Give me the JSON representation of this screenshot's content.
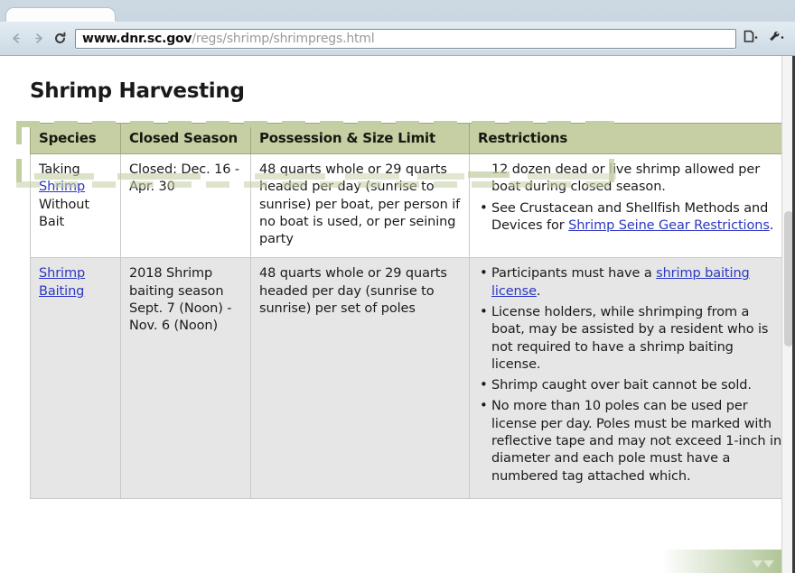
{
  "browser": {
    "tab_title": "",
    "back_icon": "back-arrow-icon",
    "forward_icon": "forward-arrow-icon",
    "reload_icon": "reload-icon",
    "url_host": "www.dnr.sc.gov",
    "url_path": "/regs/shrimp/shrimpregs.html",
    "url_full": "www.dnr.sc.gov/regs/shrimp/shrimpregs.html",
    "page_menu_icon": "page-menu-icon",
    "wrench_menu_icon": "wrench-menu-icon"
  },
  "page": {
    "title": "Shrimp Harvesting",
    "table": {
      "headers": [
        "Species",
        "Closed Season",
        "Possession & Size Limit",
        "Restrictions"
      ],
      "rows": [
        {
          "species_prefix": "Taking ",
          "species_link": "Shrimp",
          "species_suffix": " Without Bait",
          "closed_season": "Closed: Dec. 16 - Apr. 30",
          "possession": "48 quarts whole or 29 quarts headed per day (sunrise to sunrise) per boat, per person if no boat is used, or per seining party",
          "restrictions": [
            {
              "text_before": "12 dozen dead or live shrimp allowed per boat during closed season.",
              "link": "",
              "text_after": "",
              "bulleted": false
            },
            {
              "text_before": "See Crustacean and Shellfish Methods and Devices for ",
              "link": "Shrimp Seine Gear Restrictions",
              "text_after": ".",
              "bulleted": true
            }
          ]
        },
        {
          "species_prefix": "",
          "species_link": "Shrimp Baiting",
          "species_suffix": "",
          "closed_season": "2018 Shrimp baiting season Sept. 7 (Noon) - Nov. 6 (Noon)",
          "possession": "48 quarts whole or 29 quarts headed per day (sunrise to sunrise) per set of poles",
          "restrictions": [
            {
              "text_before": "Participants must have a ",
              "link": "shrimp baiting license",
              "text_after": ".",
              "bulleted": true
            },
            {
              "text_before": "License holders, while shrimping from a boat, may be assisted by a resident who is not required to have a shrimp baiting license.",
              "link": "",
              "text_after": "",
              "bulleted": true
            },
            {
              "text_before": "Shrimp caught over bait cannot be sold.",
              "link": "",
              "text_after": "",
              "bulleted": true
            },
            {
              "text_before": "No more than 10 poles can be used per license per day. Poles must be marked with reflective tape and may not exceed 1-inch in diameter and each pole must have a numbered tag attached which.",
              "link": "",
              "text_after": "",
              "bulleted": true
            }
          ]
        }
      ]
    }
  },
  "colors": {
    "header_green": "#c6cfa4",
    "link_blue": "#2b37c4",
    "row_gray": "#e6e6e6",
    "marquee_green": "#c3cfa2",
    "chrome_blue": "#cdd9e2"
  },
  "overlay": {
    "selection_marquee": "dashed-selection-rectangle",
    "watermark": "green-corner-watermark"
  }
}
